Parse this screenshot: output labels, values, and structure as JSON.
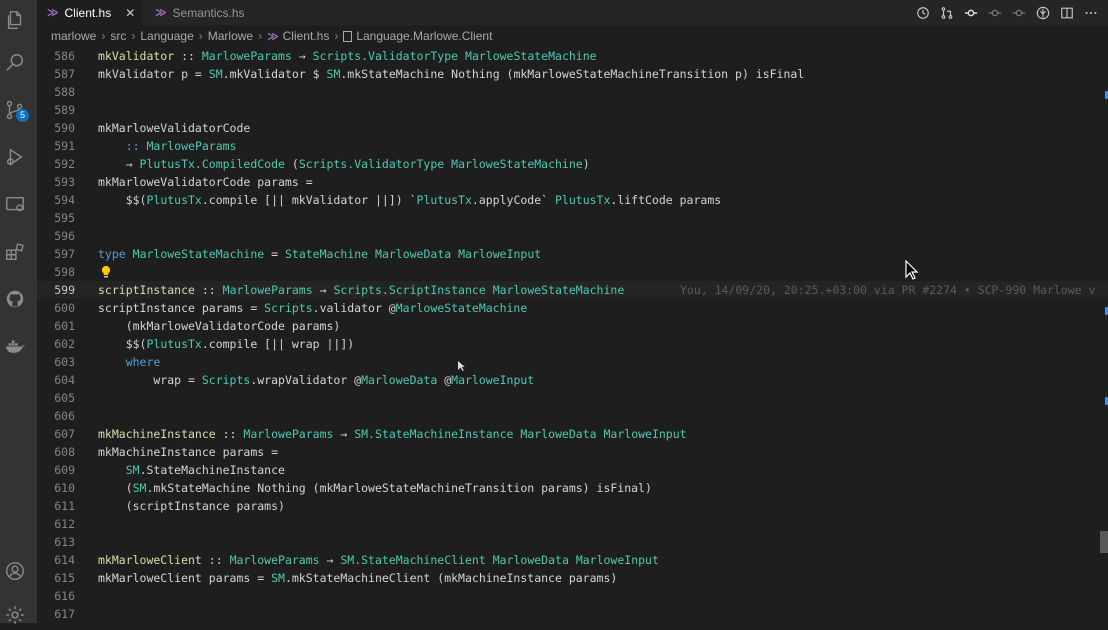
{
  "tabs": [
    {
      "label": "Client.hs",
      "active": true,
      "icon": "haskell-icon"
    },
    {
      "label": "Semantics.hs",
      "active": false,
      "icon": "haskell-icon"
    }
  ],
  "tab_close_glyph": "✕",
  "haskell_glyph": "≫",
  "breadcrumb": {
    "items": [
      "marlowe",
      "src",
      "Language",
      "Marlowe",
      "Client.hs",
      "Language.Marlowe.Client"
    ]
  },
  "activity": {
    "items": [
      "explorer-icon",
      "search-icon",
      "source-control-icon",
      "run-debug-icon",
      "remote-explorer-icon",
      "extensions-icon",
      "github-icon",
      "docker-icon",
      "account-icon",
      "settings-gear-icon"
    ],
    "scm_badge": "5"
  },
  "colors": {
    "function": "#dcdcaa",
    "type": "#4ec9b0",
    "keyword": "#569cd6",
    "plain": "#d4d4d4",
    "line_number": "#858585",
    "blame": "#5a5a5a",
    "accent": "#3794ff"
  },
  "editor": {
    "current_line": "599",
    "blame": "You, 14/09/20, 20:25.+03:00 via PR #2274 • SCP-990 Marlowe v",
    "lines": [
      {
        "n": "586",
        "tokens": [
          [
            "fn",
            "mkValidator"
          ],
          [
            "pl",
            " :: "
          ],
          [
            "ty",
            "MarloweParams"
          ],
          [
            "pl",
            " → "
          ],
          [
            "ty",
            "Scripts.ValidatorType"
          ],
          [
            "pl",
            " "
          ],
          [
            "ty",
            "MarloweStateMachine"
          ]
        ]
      },
      {
        "n": "587",
        "tokens": [
          [
            "pl",
            "mkValidator p = "
          ],
          [
            "ty",
            "SM"
          ],
          [
            "pl",
            "."
          ],
          [
            "pl",
            "mkValidator $ "
          ],
          [
            "ty",
            "SM"
          ],
          [
            "pl",
            ".mkStateMachine Nothing (mkMarloweStateMachineTransition p) isFinal"
          ]
        ]
      },
      {
        "n": "588",
        "tokens": []
      },
      {
        "n": "589",
        "tokens": []
      },
      {
        "n": "590",
        "tokens": [
          [
            "pl",
            "mkMarloweValidatorCode"
          ]
        ]
      },
      {
        "n": "591",
        "tokens": [
          [
            "pl",
            "    "
          ],
          [
            "kw",
            "::"
          ],
          [
            "pl",
            " "
          ],
          [
            "ty",
            "MarloweParams"
          ]
        ]
      },
      {
        "n": "592",
        "tokens": [
          [
            "pl",
            "    → "
          ],
          [
            "ty",
            "PlutusTx.CompiledCode"
          ],
          [
            "pl",
            " ("
          ],
          [
            "ty",
            "Scripts.ValidatorType"
          ],
          [
            "pl",
            " "
          ],
          [
            "ty",
            "MarloweStateMachine"
          ],
          [
            "pl",
            ")"
          ]
        ]
      },
      {
        "n": "593",
        "tokens": [
          [
            "pl",
            "mkMarloweValidatorCode params ="
          ]
        ]
      },
      {
        "n": "594",
        "tokens": [
          [
            "pl",
            "    $$("
          ],
          [
            "ty",
            "PlutusTx"
          ],
          [
            "pl",
            "."
          ],
          [
            "pl",
            "compile [|| mkValidator ||]) `"
          ],
          [
            "ty",
            "PlutusTx"
          ],
          [
            "pl",
            ".applyCode` "
          ],
          [
            "ty",
            "PlutusTx"
          ],
          [
            "pl",
            ".liftCode params"
          ]
        ]
      },
      {
        "n": "595",
        "tokens": []
      },
      {
        "n": "596",
        "tokens": []
      },
      {
        "n": "597",
        "tokens": [
          [
            "kw",
            "type"
          ],
          [
            "pl",
            " "
          ],
          [
            "ty",
            "MarloweStateMachine"
          ],
          [
            "pl",
            " = "
          ],
          [
            "ty",
            "StateMachine"
          ],
          [
            "pl",
            " "
          ],
          [
            "ty",
            "MarloweData"
          ],
          [
            "pl",
            " "
          ],
          [
            "ty",
            "MarloweInput"
          ]
        ]
      },
      {
        "n": "598",
        "tokens": [],
        "bulb": true
      },
      {
        "n": "599",
        "tokens": [
          [
            "fn",
            "scriptInstance"
          ],
          [
            "pl",
            " :: "
          ],
          [
            "ty",
            "MarloweParams"
          ],
          [
            "pl",
            " → "
          ],
          [
            "ty",
            "Scripts.ScriptInstance"
          ],
          [
            "pl",
            " "
          ],
          [
            "ty",
            "MarloweStateMachine"
          ]
        ]
      },
      {
        "n": "600",
        "tokens": [
          [
            "pl",
            "scriptInstance params = "
          ],
          [
            "ty",
            "Scripts"
          ],
          [
            "pl",
            ".validator @"
          ],
          [
            "ty",
            "MarloweStateMachine"
          ]
        ]
      },
      {
        "n": "601",
        "tokens": [
          [
            "pl",
            "    (mkMarloweValidatorCode params)"
          ]
        ]
      },
      {
        "n": "602",
        "tokens": [
          [
            "pl",
            "    $$("
          ],
          [
            "ty",
            "PlutusTx"
          ],
          [
            "pl",
            ".compile [|| wrap ||])"
          ]
        ]
      },
      {
        "n": "603",
        "tokens": [
          [
            "pl",
            "    "
          ],
          [
            "kw",
            "where"
          ]
        ]
      },
      {
        "n": "604",
        "tokens": [
          [
            "pl",
            "        wrap = "
          ],
          [
            "ty",
            "Scripts"
          ],
          [
            "pl",
            ".wrapValidator @"
          ],
          [
            "ty",
            "MarloweData"
          ],
          [
            "pl",
            " @"
          ],
          [
            "ty",
            "MarloweInput"
          ]
        ]
      },
      {
        "n": "605",
        "tokens": []
      },
      {
        "n": "606",
        "tokens": []
      },
      {
        "n": "607",
        "tokens": [
          [
            "fn",
            "mkMachineInstance"
          ],
          [
            "pl",
            " :: "
          ],
          [
            "ty",
            "MarloweParams"
          ],
          [
            "pl",
            " → "
          ],
          [
            "ty",
            "SM.StateMachineInstance"
          ],
          [
            "pl",
            " "
          ],
          [
            "ty",
            "MarloweData"
          ],
          [
            "pl",
            " "
          ],
          [
            "ty",
            "MarloweInput"
          ]
        ]
      },
      {
        "n": "608",
        "tokens": [
          [
            "pl",
            "mkMachineInstance params ="
          ]
        ]
      },
      {
        "n": "609",
        "tokens": [
          [
            "pl",
            "    "
          ],
          [
            "ty",
            "SM"
          ],
          [
            "pl",
            ".StateMachineInstance"
          ]
        ]
      },
      {
        "n": "610",
        "tokens": [
          [
            "pl",
            "    ("
          ],
          [
            "ty",
            "SM"
          ],
          [
            "pl",
            ".mkStateMachine Nothing (mkMarloweStateMachineTransition params) isFinal)"
          ]
        ]
      },
      {
        "n": "611",
        "tokens": [
          [
            "pl",
            "    (scriptInstance params)"
          ]
        ]
      },
      {
        "n": "612",
        "tokens": []
      },
      {
        "n": "613",
        "tokens": []
      },
      {
        "n": "614",
        "tokens": [
          [
            "fn",
            "mkMarloweClient"
          ],
          [
            "pl",
            " :: "
          ],
          [
            "ty",
            "MarloweParams"
          ],
          [
            "pl",
            " → "
          ],
          [
            "ty",
            "SM.StateMachineClient"
          ],
          [
            "pl",
            " "
          ],
          [
            "ty",
            "MarloweData"
          ],
          [
            "pl",
            " "
          ],
          [
            "ty",
            "MarloweInput"
          ]
        ]
      },
      {
        "n": "615",
        "tokens": [
          [
            "pl",
            "mkMarloweClient params = "
          ],
          [
            "ty",
            "SM"
          ],
          [
            "pl",
            ".mkStateMachineClient (mkMachineInstance params)"
          ]
        ]
      },
      {
        "n": "616",
        "tokens": []
      },
      {
        "n": "617",
        "tokens": []
      }
    ]
  }
}
